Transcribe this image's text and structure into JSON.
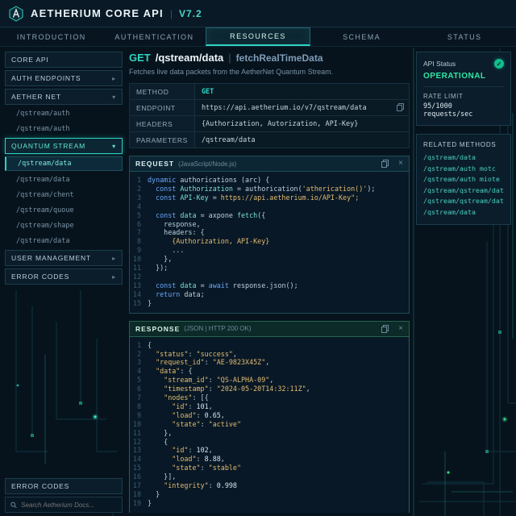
{
  "colors": {
    "accent": "#2fd4c0",
    "operational": "#2ee6a8",
    "string": "#e3bb72",
    "keyword": "#6aa6f8"
  },
  "header": {
    "title": "AETHERIUM CORE API",
    "separator": "|",
    "version": "V7.2"
  },
  "nav": {
    "tabs": [
      {
        "label": "INTRODUCTION",
        "active": false
      },
      {
        "label": "AUTHENTICATION",
        "active": false
      },
      {
        "label": "RESOURCES",
        "active": true
      },
      {
        "label": "SCHEMA",
        "active": false
      },
      {
        "label": "STATUS",
        "active": false
      }
    ]
  },
  "sidebar": {
    "items": [
      {
        "label": "CORE API",
        "type": "header"
      },
      {
        "label": "AUTH ENDPOINTS",
        "type": "header",
        "chevron": "right"
      },
      {
        "label": "AETHER NET",
        "type": "header",
        "chevron": "down"
      },
      {
        "label": "/qstream/auth",
        "type": "sub"
      },
      {
        "label": "/qstream/auth",
        "type": "sub"
      },
      {
        "label": "QUANTUM STREAM",
        "type": "header",
        "chevron": "down",
        "active": true
      },
      {
        "label": "/qstream/data",
        "type": "sub",
        "active": true
      },
      {
        "label": "/qstream/data",
        "type": "sub"
      },
      {
        "label": "/qstream/chent",
        "type": "sub"
      },
      {
        "label": "/qstream/quoue",
        "type": "sub"
      },
      {
        "label": "/qstream/shape",
        "type": "sub"
      },
      {
        "label": "/qstream/data",
        "type": "sub"
      },
      {
        "label": "USER MANAGEMENT",
        "type": "header",
        "chevron": "right"
      },
      {
        "label": "ERROR CODES",
        "type": "header",
        "chevron": "right"
      }
    ],
    "footer_item": "ERROR CODES",
    "search_placeholder": "Search Aetherium Docs..."
  },
  "endpoint": {
    "method": "GET",
    "path": "/qstream/data",
    "separator": "|",
    "name": "fetchRealTimeData",
    "description": "Fetches live data packets from the AetherNet Quantum Stream."
  },
  "info_table": {
    "rows": [
      {
        "key": "METHOD",
        "value": "GET",
        "value_class": "get"
      },
      {
        "key": "ENDPOINT",
        "value": "https://api.aetherium.io/v7/qstream/data",
        "copy": true
      },
      {
        "key": "HEADERS",
        "value": "{Authorization, Autorization, API-Key}"
      },
      {
        "key": "PARAMETERS",
        "value": "/qstream/data"
      }
    ]
  },
  "request_panel": {
    "title": "REQUEST",
    "subtitle": "(JavaScript/Node.js)",
    "lines": [
      [
        [
          "kw",
          "dynamic"
        ],
        [
          "pln",
          " authorications (arc) {"
        ]
      ],
      [
        [
          "pln",
          "  "
        ],
        [
          "kw",
          "const"
        ],
        [
          "id",
          " Authorization"
        ],
        [
          "pln",
          " = authorication("
        ],
        [
          "str",
          "'atherication()'"
        ],
        [
          "pln",
          ");"
        ]
      ],
      [
        [
          "pln",
          "  "
        ],
        [
          "kw",
          "const"
        ],
        [
          "id",
          " API-Key"
        ],
        [
          "pln",
          " = "
        ],
        [
          "str",
          "https://api.aetherium.io/API-Key\";"
        ]
      ],
      [],
      [
        [
          "pln",
          "  "
        ],
        [
          "kw",
          "const"
        ],
        [
          "id",
          " data"
        ],
        [
          "pln",
          " = axpone "
        ],
        [
          "id",
          "fetch"
        ],
        [
          "pln",
          "({"
        ]
      ],
      [
        [
          "pln",
          "    response,"
        ]
      ],
      [
        [
          "pln",
          "    headers: {"
        ]
      ],
      [
        [
          "pln",
          "      "
        ],
        [
          "str",
          "{Authorization, API-Key}"
        ]
      ],
      [
        [
          "pln",
          "      ..."
        ]
      ],
      [
        [
          "pln",
          "    },"
        ]
      ],
      [
        [
          "pln",
          "  });"
        ]
      ],
      [],
      [
        [
          "pln",
          "  "
        ],
        [
          "kw",
          "const"
        ],
        [
          "id",
          " data"
        ],
        [
          "pln",
          " = "
        ],
        [
          "kw",
          "await"
        ],
        [
          "pln",
          " response.json();"
        ]
      ],
      [
        [
          "pln",
          "  "
        ],
        [
          "kw",
          "return"
        ],
        [
          "pln",
          " data;"
        ]
      ],
      [
        [
          "pln",
          "}"
        ]
      ]
    ]
  },
  "response_panel": {
    "title": "RESPONSE",
    "subtitle": "(JSON | HTTP 200 OK)",
    "lines": [
      [
        [
          "pln",
          "{"
        ]
      ],
      [
        [
          "pln",
          "  "
        ],
        [
          "str",
          "\"status\""
        ],
        [
          "pln",
          ": "
        ],
        [
          "str",
          "\"success\""
        ],
        [
          "pln",
          ","
        ]
      ],
      [
        [
          "pln",
          "  "
        ],
        [
          "str",
          "\"request_id\""
        ],
        [
          "pln",
          ": "
        ],
        [
          "str",
          "\"AE-9823X45Z\""
        ],
        [
          "pln",
          ","
        ]
      ],
      [
        [
          "pln",
          "  "
        ],
        [
          "str",
          "\"data\""
        ],
        [
          "pln",
          ": {"
        ]
      ],
      [
        [
          "pln",
          "    "
        ],
        [
          "str",
          "\"stream_id\""
        ],
        [
          "pln",
          ": "
        ],
        [
          "str",
          "\"QS-ALPHA-09\""
        ],
        [
          "pln",
          ","
        ]
      ],
      [
        [
          "pln",
          "    "
        ],
        [
          "str",
          "\"timestamp\""
        ],
        [
          "pln",
          ": "
        ],
        [
          "str",
          "\"2024-05-20T14:32:11Z\""
        ],
        [
          "pln",
          ","
        ]
      ],
      [
        [
          "pln",
          "    "
        ],
        [
          "str",
          "\"nodes\""
        ],
        [
          "pln",
          ": [{"
        ]
      ],
      [
        [
          "pln",
          "      "
        ],
        [
          "str",
          "\"id\""
        ],
        [
          "pln",
          ": "
        ],
        [
          "num",
          "101"
        ],
        [
          "pln",
          ","
        ]
      ],
      [
        [
          "pln",
          "      "
        ],
        [
          "str",
          "\"load\""
        ],
        [
          "pln",
          ": "
        ],
        [
          "num",
          "0.65"
        ],
        [
          "pln",
          ","
        ]
      ],
      [
        [
          "pln",
          "      "
        ],
        [
          "str",
          "\"state\""
        ],
        [
          "pln",
          ": "
        ],
        [
          "str",
          "\"active\""
        ]
      ],
      [
        [
          "pln",
          "    },"
        ]
      ],
      [
        [
          "pln",
          "    {"
        ]
      ],
      [
        [
          "pln",
          "      "
        ],
        [
          "str",
          "\"id\""
        ],
        [
          "pln",
          ": "
        ],
        [
          "num",
          "102"
        ],
        [
          "pln",
          ","
        ]
      ],
      [
        [
          "pln",
          "      "
        ],
        [
          "str",
          "\"load\""
        ],
        [
          "pln",
          ": "
        ],
        [
          "num",
          "8.88"
        ],
        [
          "pln",
          ","
        ]
      ],
      [
        [
          "pln",
          "      "
        ],
        [
          "str",
          "\"state\""
        ],
        [
          "pln",
          ": "
        ],
        [
          "str",
          "\"stable\""
        ]
      ],
      [
        [
          "pln",
          "    }],"
        ]
      ],
      [
        [
          "pln",
          "    "
        ],
        [
          "str",
          "\"integrity\""
        ],
        [
          "pln",
          ": "
        ],
        [
          "num",
          "0.998"
        ]
      ],
      [
        [
          "pln",
          "  }"
        ]
      ],
      [
        [
          "pln",
          "}"
        ]
      ]
    ]
  },
  "status_panel": {
    "title": "API Status",
    "status": "OPERATIONAL",
    "rate_limit_label": "RATE LIMIT",
    "rate_limit_value": "95/1000 requests/sec"
  },
  "related": {
    "title": "RELATED METHODS",
    "links": [
      "/qstream/data",
      "/qstream/auth motc",
      "/qstream/auth miote",
      "/qstream/qstream/data",
      "/qstream/qstream/data",
      "/qstream/data"
    ]
  },
  "icons": {
    "check": "✓",
    "close": "×",
    "chevron_right": "▸",
    "chevron_down": "▾"
  }
}
